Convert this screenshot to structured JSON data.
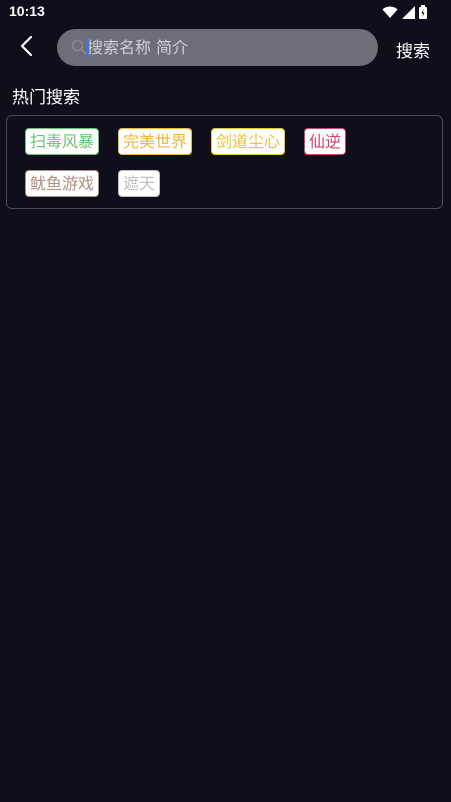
{
  "status_bar": {
    "time": "10:13"
  },
  "search": {
    "placeholder": "搜索名称 简介",
    "button_label": "搜索"
  },
  "hot_search": {
    "title": "热门搜索",
    "tags": [
      {
        "label": "扫毒风暴",
        "color": "#6cc070"
      },
      {
        "label": "完美世界",
        "color": "#f0b438"
      },
      {
        "label": "剑道尘心",
        "color": "#e8c430"
      },
      {
        "label": "仙逆",
        "color": "#d2456a"
      },
      {
        "label": "鱿鱼游戏",
        "color": "#b09080"
      },
      {
        "label": "遮天",
        "color": "#bdbdbd"
      }
    ]
  }
}
